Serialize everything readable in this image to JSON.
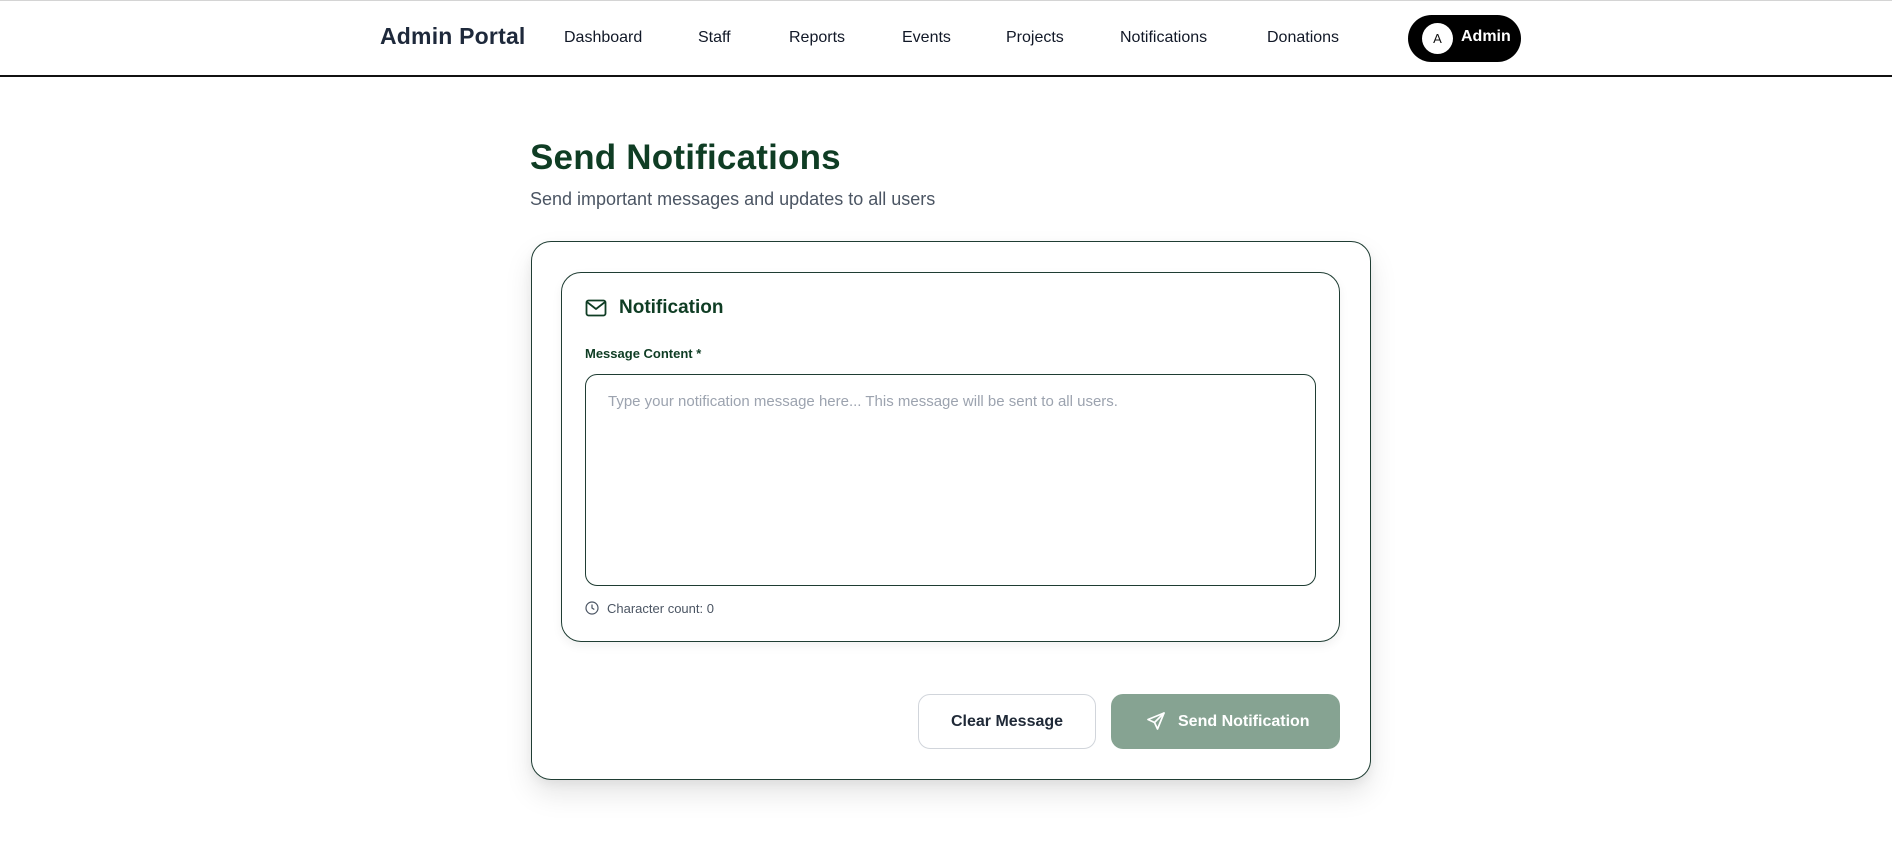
{
  "navbar": {
    "brand": "Admin Portal",
    "links": [
      "Dashboard",
      "Staff",
      "Reports",
      "Events",
      "Projects",
      "Notifications",
      "Donations"
    ],
    "user": {
      "initial": "A",
      "name": "Admin"
    }
  },
  "page": {
    "title": "Send Notifications",
    "subtitle": "Send important messages and updates to all users"
  },
  "form": {
    "section_title": "Notification",
    "field_label": "Message Content *",
    "placeholder": "Type your notification message here... This message will be sent to all users.",
    "value": "",
    "char_count": "Character count: 0"
  },
  "actions": {
    "clear_label": "Clear Message",
    "send_label": "Send Notification"
  },
  "colors": {
    "brand_green": "#0f3d24",
    "send_button": "#86a392",
    "admin_pill": "#000000"
  },
  "icons": {
    "section": "mail-icon",
    "char_count": "clock-icon",
    "send": "send-icon"
  }
}
